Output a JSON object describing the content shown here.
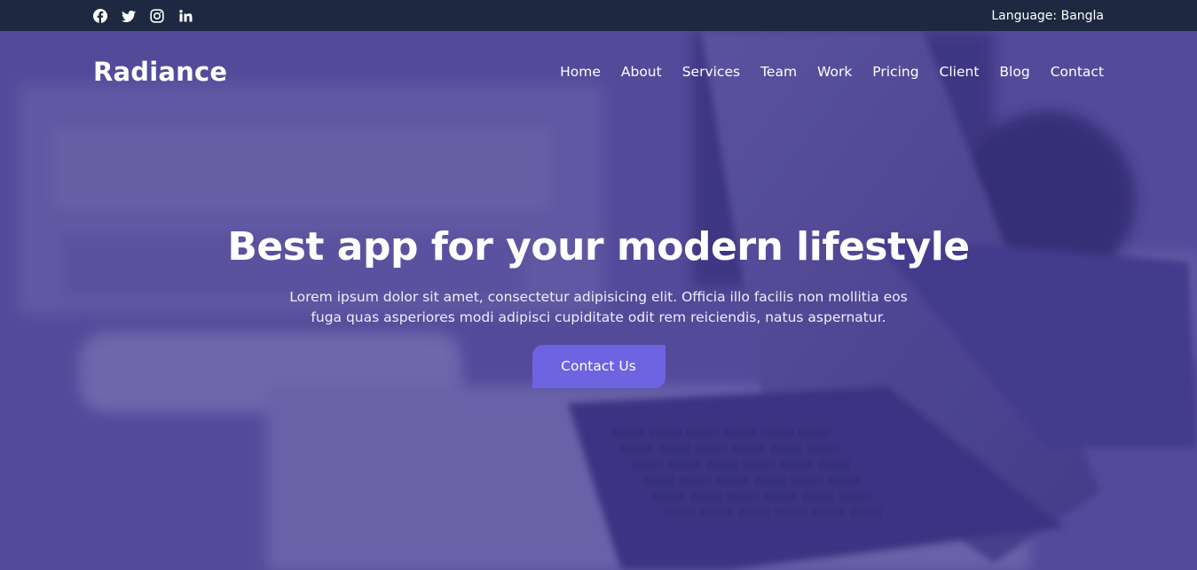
{
  "topbar": {
    "socials": [
      {
        "icon": "facebook-icon"
      },
      {
        "icon": "twitter-icon"
      },
      {
        "icon": "instagram-icon"
      },
      {
        "icon": "linkedin-icon"
      }
    ],
    "language_label": "Language: Bangla"
  },
  "nav": {
    "brand": "Radiance",
    "items": [
      {
        "label": "Home"
      },
      {
        "label": "About"
      },
      {
        "label": "Services"
      },
      {
        "label": "Team"
      },
      {
        "label": "Work"
      },
      {
        "label": "Pricing"
      },
      {
        "label": "Client"
      },
      {
        "label": "Blog"
      },
      {
        "label": "Contact"
      }
    ]
  },
  "hero": {
    "title": "Best app for your modern lifestyle",
    "text": "Lorem ipsum dolor sit amet, consectetur adipisicing elit. Officia illo facilis non mollitia eos fuga quas asperiores modi adipisci cupiditate odit rem reiciendis, natus aspernatur.",
    "cta_label": "Contact Us"
  },
  "colors": {
    "topbar_bg": "#1e2840",
    "hero_overlay": "#4a4096",
    "accent": "#6e63e0"
  }
}
